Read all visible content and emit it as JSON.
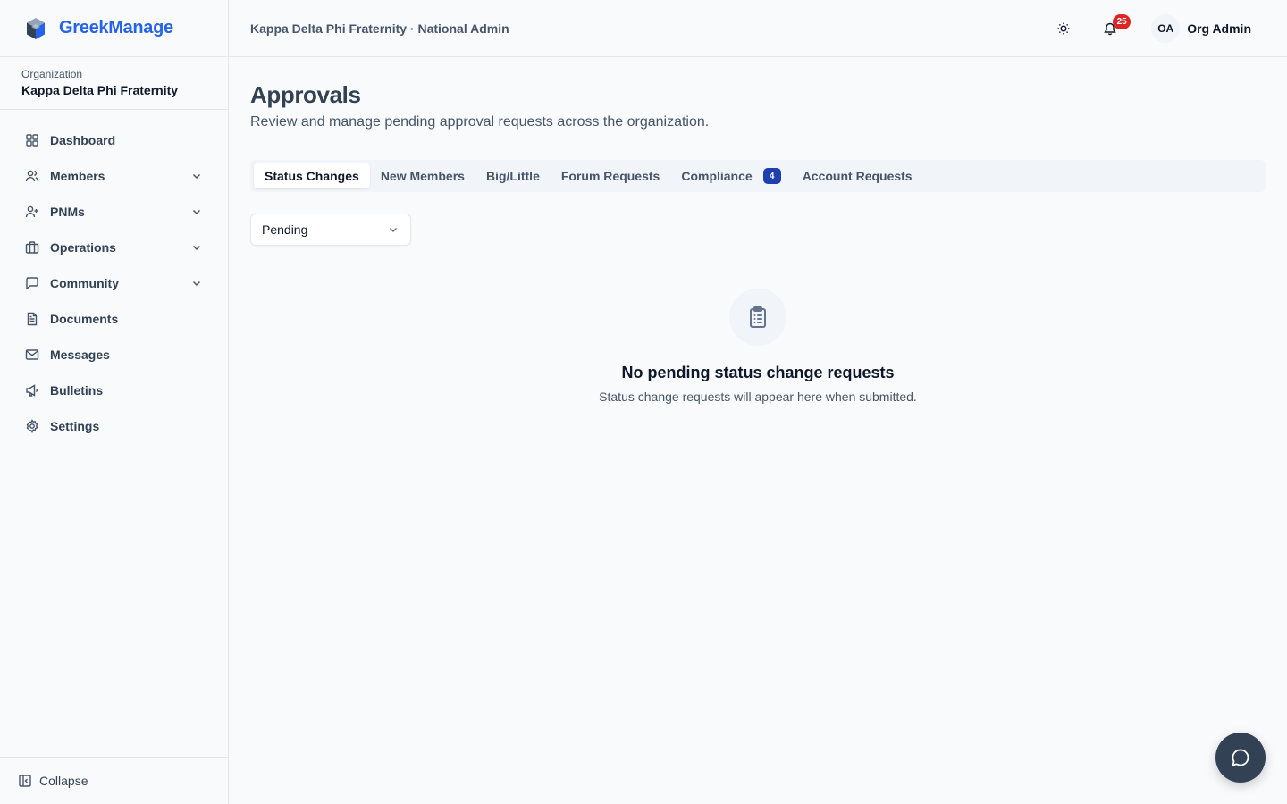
{
  "brand": {
    "name": "GreekManage",
    "logo_icon": "cube-logo-icon",
    "color": "#2563eb"
  },
  "organization": {
    "label": "Organization",
    "name": "Kappa Delta Phi Fraternity"
  },
  "sidebar": {
    "items": [
      {
        "label": "Dashboard",
        "icon": "dashboard-icon",
        "has_submenu": false
      },
      {
        "label": "Members",
        "icon": "users-icon",
        "has_submenu": true
      },
      {
        "label": "PNMs",
        "icon": "user-plus-icon",
        "has_submenu": true
      },
      {
        "label": "Operations",
        "icon": "briefcase-icon",
        "has_submenu": true
      },
      {
        "label": "Community",
        "icon": "chat-square-icon",
        "has_submenu": true
      },
      {
        "label": "Documents",
        "icon": "document-icon",
        "has_submenu": false
      },
      {
        "label": "Messages",
        "icon": "mail-icon",
        "has_submenu": false
      },
      {
        "label": "Bulletins",
        "icon": "megaphone-icon",
        "has_submenu": false
      },
      {
        "label": "Settings",
        "icon": "gear-icon",
        "has_submenu": false
      }
    ],
    "collapse_label": "Collapse"
  },
  "header": {
    "breadcrumb": "Kappa Delta Phi Fraternity · National Admin",
    "notification_count": "25",
    "user_initials": "OA",
    "user_name": "Org Admin"
  },
  "main": {
    "title": "Approvals",
    "subtitle": "Review and manage pending approval requests across the organization.",
    "tabs": [
      {
        "label": "Status Changes",
        "active": true,
        "badge": ""
      },
      {
        "label": "New Members",
        "active": false,
        "badge": ""
      },
      {
        "label": "Big/Little",
        "active": false,
        "badge": ""
      },
      {
        "label": "Forum Requests",
        "active": false,
        "badge": ""
      },
      {
        "label": "Compliance",
        "active": false,
        "badge": "4"
      },
      {
        "label": "Account Requests",
        "active": false,
        "badge": ""
      }
    ],
    "filter": {
      "selected": "Pending"
    },
    "empty_state": {
      "icon": "clipboard-list-icon",
      "title": "No pending status change requests",
      "subtitle": "Status change requests will appear here when submitted."
    }
  },
  "colors": {
    "notification_badge": "#dc2626",
    "tab_badge": "#1e40af",
    "chat_fab": "#334155"
  }
}
